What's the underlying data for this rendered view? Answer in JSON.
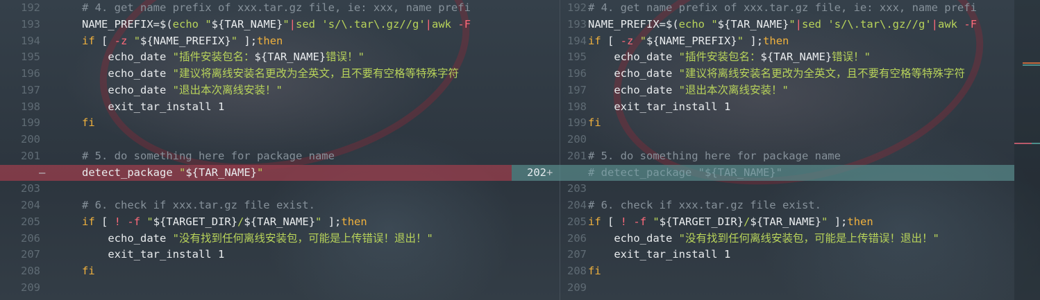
{
  "colors": {
    "deleted_bg": "#963e4b",
    "added_bg": "#588c8c",
    "comment": "#86919a",
    "keyword": "#f0b13d",
    "string": "#b8d35a",
    "operator": "#ff6a7a"
  },
  "left_pane": {
    "rows": [
      {
        "num": "192",
        "type": "normal",
        "code": "# 4. get name prefix of xxx.tar.gz file, ie: xxx, name prefi"
      },
      {
        "num": "193",
        "type": "normal",
        "code": "NAME_PREFIX=$(echo \"${TAR_NAME}\"|sed 's/\\.tar\\.gz//g'|awk -F"
      },
      {
        "num": "194",
        "type": "normal",
        "code": "if [ -z \"${NAME_PREFIX}\" ];then"
      },
      {
        "num": "195",
        "type": "normal",
        "code": "    echo_date \"插件安装包名：${TAR_NAME}错误！\""
      },
      {
        "num": "196",
        "type": "normal",
        "code": "    echo_date \"建议将离线安装名更改为全英文，且不要有空格等特殊字符"
      },
      {
        "num": "197",
        "type": "normal",
        "code": "    echo_date \"退出本次离线安装！\""
      },
      {
        "num": "198",
        "type": "normal",
        "code": "    exit_tar_install 1"
      },
      {
        "num": "199",
        "type": "normal",
        "code": "fi"
      },
      {
        "num": "200",
        "type": "normal",
        "code": ""
      },
      {
        "num": "201",
        "type": "normal",
        "code": "# 5. do something here for package name"
      },
      {
        "num": "",
        "type": "del",
        "marker": "—",
        "code": "detect_package \"${TAR_NAME}\""
      },
      {
        "num": "203",
        "type": "normal",
        "code": ""
      },
      {
        "num": "204",
        "type": "normal",
        "code": "# 6. check if xxx.tar.gz file exist."
      },
      {
        "num": "205",
        "type": "normal",
        "code": "if [ ! -f \"${TARGET_DIR}/${TAR_NAME}\" ];then"
      },
      {
        "num": "206",
        "type": "normal",
        "code": "    echo_date \"没有找到任何离线安装包，可能是上传错误！退出！\""
      },
      {
        "num": "207",
        "type": "normal",
        "code": "    exit_tar_install 1"
      },
      {
        "num": "208",
        "type": "normal",
        "code": "fi"
      },
      {
        "num": "209",
        "type": "normal",
        "code": ""
      }
    ]
  },
  "right_pane": {
    "rows": [
      {
        "num": "192",
        "type": "normal",
        "code": "# 4. get name prefix of xxx.tar.gz file, ie: xxx, name prefi"
      },
      {
        "num": "193",
        "type": "normal",
        "code": "NAME_PREFIX=$(echo \"${TAR_NAME}\"|sed 's/\\.tar\\.gz//g'|awk -F"
      },
      {
        "num": "194",
        "type": "normal",
        "code": "if [ -z \"${NAME_PREFIX}\" ];then"
      },
      {
        "num": "195",
        "type": "normal",
        "code": "    echo_date \"插件安装包名：${TAR_NAME}错误！\""
      },
      {
        "num": "196",
        "type": "normal",
        "code": "    echo_date \"建议将离线安装名更改为全英文，且不要有空格等特殊字符"
      },
      {
        "num": "197",
        "type": "normal",
        "code": "    echo_date \"退出本次离线安装！\""
      },
      {
        "num": "198",
        "type": "normal",
        "code": "    exit_tar_install 1"
      },
      {
        "num": "199",
        "type": "normal",
        "code": "fi"
      },
      {
        "num": "200",
        "type": "normal",
        "code": ""
      },
      {
        "num": "201",
        "type": "normal",
        "code": "# 5. do something here for package name"
      },
      {
        "num": "202",
        "type": "add",
        "marker": "+",
        "code": "# detect_package \"${TAR_NAME}\""
      },
      {
        "num": "203",
        "type": "normal",
        "code": ""
      },
      {
        "num": "204",
        "type": "normal",
        "code": "# 6. check if xxx.tar.gz file exist."
      },
      {
        "num": "205",
        "type": "normal",
        "code": "if [ ! -f \"${TARGET_DIR}/${TAR_NAME}\" ];then"
      },
      {
        "num": "206",
        "type": "normal",
        "code": "    echo_date \"没有找到任何离线安装包，可能是上传错误！退出！\""
      },
      {
        "num": "207",
        "type": "normal",
        "code": "    exit_tar_install 1"
      },
      {
        "num": "208",
        "type": "normal",
        "code": "fi"
      },
      {
        "num": "209",
        "type": "normal",
        "code": ""
      }
    ]
  }
}
